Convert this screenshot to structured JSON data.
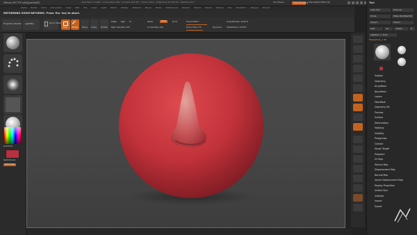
{
  "app": {
    "title": "ZBrush 4R7 P3 (x64)(Joe5ie82)",
    "stats": "• Free Mem 1.70GB • Active Mem 469 • Scratch Disk 96 • Timer 0.014 • PolyCount 44.755 KP • MeshCount 1",
    "quicksave": "QuickSave",
    "see_through": "See-through 0",
    "default_label": "Menus",
    "script_label": "DefaultZScript"
  },
  "menus": [
    "Alpha",
    "Brush",
    "Color",
    "Document",
    "Draw",
    "Edit",
    "File",
    "Layer",
    "Light",
    "Macro",
    "Marker",
    "Material",
    "Movie",
    "Picker",
    "Preferences",
    "Render",
    "Stencil",
    "Stroke",
    "Texture",
    "Tool",
    "Transform",
    "Zplugin",
    "Zscript"
  ],
  "message": "REFORMING ZOOM REFORMS. Press 'Esc' key to abort.",
  "toolbar": {
    "projection_master": "Projection Master",
    "lightbox": "LightBox",
    "quick_sketch": "Quick Sketch",
    "edit": "Edit",
    "draw": "Draw",
    "move": "Move",
    "scale": "Scale",
    "rotate": "Rotate",
    "mrgb": "Mrgb",
    "rgb": "Rgb",
    "m": "M",
    "zadd": "Zadd",
    "zsub": "Zsub",
    "zcut": "Zcut",
    "focal_shift": "Focal Shift 0",
    "draw_size": "Draw Size 172",
    "z_intensity": "Z Intensity 100",
    "dynamic": "Dynamic",
    "active_points": "ActivePoints: 44,874",
    "total_points": "TotalPoints: 44,874",
    "rgb_intensity": "Rgb Intensity 100"
  },
  "leftshelf": {
    "gradient": "Gradient",
    "switch_color": "SwitchColor",
    "alternate": "Alternate"
  },
  "tray": {
    "header": "Tool",
    "buttons": [
      "Load Tool",
      "Save As",
      "Clone",
      "Make PolyMesh3D",
      "Import",
      "Export",
      "GoZ",
      "All",
      "Visible",
      "R",
      "Lightbox > Tools"
    ],
    "polysphere": "PolySphere_1 48",
    "subtool_items": [
      "Subtool",
      "Geometry",
      "ArrayMesh",
      "NanoMesh",
      "Layers",
      "FiberMesh",
      "Geometry HD",
      "Preview",
      "Surface",
      "Deformation",
      "Masking",
      "Visibility",
      "Polygroups",
      "Contact",
      "Morph Target",
      "Polypaint",
      "UV Map",
      "Texture Map",
      "Displacement Map",
      "Normal Map",
      "Vector Displacement Map",
      "Display Properties",
      "Unified Skin",
      "Initialize",
      "Import",
      "Export"
    ]
  },
  "colors": {
    "accent": "#c4621f",
    "sphere": "#c8333b",
    "background": "#484848"
  }
}
